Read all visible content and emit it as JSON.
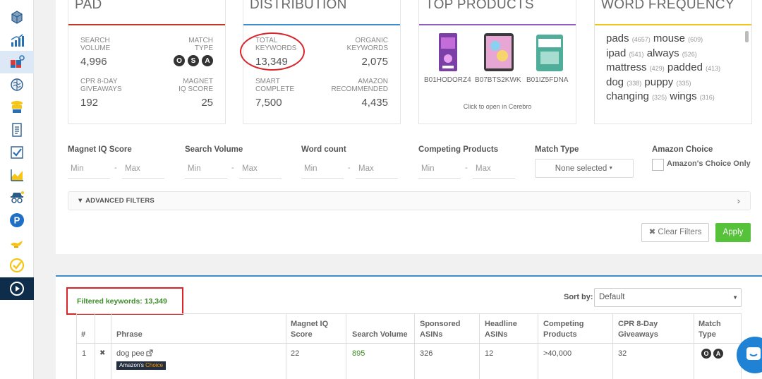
{
  "sidebar": {
    "items": [
      {
        "icon": "box-3d-icon"
      },
      {
        "icon": "bar-chart-icon"
      },
      {
        "icon": "magnet-puzzle-icon",
        "active": true
      },
      {
        "icon": "brain-icon"
      },
      {
        "icon": "stack-box-icon"
      },
      {
        "icon": "document-icon"
      },
      {
        "icon": "checklist-icon"
      },
      {
        "icon": "area-chart-icon"
      },
      {
        "icon": "spy-icon"
      },
      {
        "icon": "parking-icon"
      },
      {
        "icon": "genie-lamp-icon"
      },
      {
        "icon": "check-circle-icon"
      },
      {
        "icon": "play-icon"
      }
    ]
  },
  "cards": {
    "pad": {
      "title": "PAD",
      "search_volume_label": "SEARCH\nVOLUME",
      "search_volume": "4,996",
      "match_type_label": "MATCH\nTYPE",
      "match_badges": [
        "O",
        "S",
        "A"
      ],
      "cpr_label": "CPR 8-DAY\nGIVEAWAYS",
      "cpr_value": "192",
      "magnet_label": "MAGNET\nIQ SCORE",
      "magnet_value": "25"
    },
    "distribution": {
      "title": "DISTRIBUTION",
      "total_label": "TOTAL\nKEYWORDS",
      "total_value": "13,349",
      "organic_label": "ORGANIC\nKEYWORDS",
      "organic_value": "2,075",
      "smart_label": "SMART\nCOMPLETE",
      "smart_value": "7,500",
      "amazon_label": "AMAZON\nRECOMMENDED",
      "amazon_value": "4,435"
    },
    "top_products": {
      "title": "TOP PRODUCTS",
      "products": [
        "B01HODORZ4",
        "B07BTS2KWK",
        "B01IZ5FDNA"
      ],
      "footer": "Click to open in Cerebro"
    },
    "word_frequency": {
      "title": "WORD FREQUENCY",
      "words": [
        {
          "w1": "pads",
          "c1": "(4657)",
          "w2": "mouse",
          "c2": "(609)"
        },
        {
          "w1": "ipad",
          "c1": "(541)",
          "w2": "always",
          "c2": "(526)"
        },
        {
          "w1": "mattress",
          "c1": "(429)",
          "w2": "padded",
          "c2": "(413)"
        },
        {
          "w1": "dog",
          "c1": "(338)",
          "w2": "puppy",
          "c2": "(335)"
        },
        {
          "w1": "changing",
          "c1": "(325)",
          "w2": "wings",
          "c2": "(316)"
        }
      ]
    }
  },
  "filters": {
    "magnet_iq": "Magnet IQ Score",
    "search_volume": "Search Volume",
    "word_count": "Word count",
    "competing": "Competing Products",
    "match_type": "Match Type",
    "amazon_choice": "Amazon Choice",
    "min": "Min",
    "max": "Max",
    "dash": "-",
    "match_type_value": "None selected",
    "amazon_choice_only": "Amazon's Choice Only",
    "advanced": "ADVANCED FILTERS",
    "clear": "Clear Filters",
    "apply": "Apply"
  },
  "results": {
    "filtered": "Filtered keywords: 13,349",
    "sort_label": "Sort by:",
    "sort_value": "Default",
    "columns": [
      "#",
      "Phrase",
      "Magnet IQ\nScore",
      "Search Volume",
      "Sponsored\nASINs",
      "Headline\nASINs",
      "Competing\nProducts",
      "CPR 8-Day\nGiveaways",
      "Match\nType"
    ],
    "row": {
      "num": "1",
      "remove": "✖",
      "phrase": "dog pee",
      "badge_a": "Amazon's",
      "badge_b": "Choice",
      "magnet": "22",
      "volume": "895",
      "sponsored": "326",
      "headline": "12",
      "competing": ">40,000",
      "cpr": "32",
      "match": [
        "O",
        "A"
      ]
    }
  },
  "colors": {
    "pad_bar": "#c0392b",
    "distribution_bar": "#3b8fd1",
    "top_products_bar": "#8e5fbf",
    "word_freq_bar": "#f0c419",
    "apply": "#56c23a",
    "highlight": "#d9242a",
    "green_text": "#3d8f2b"
  }
}
